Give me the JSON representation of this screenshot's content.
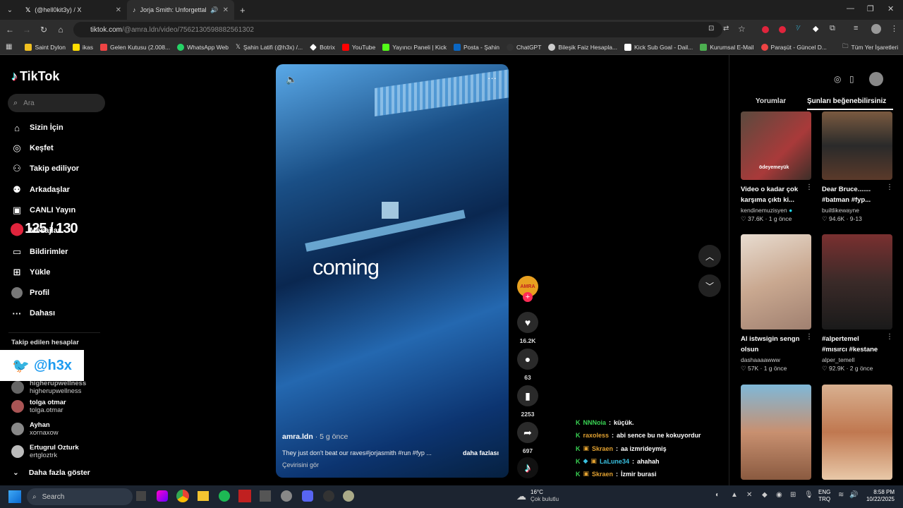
{
  "browser": {
    "tabs": [
      {
        "label": "(@hell0kit3y) / X",
        "active": false
      },
      {
        "label": "Jorja Smith: Unforgettable",
        "active": true
      }
    ],
    "url_host": "tiktok.com",
    "url_path": "/@amra.ldn/video/7562130598882561302",
    "bookmarks": [
      "Saint Dylon",
      "ikas",
      "Gelen Kutusu (2.008...",
      "WhatsApp Web",
      "Şahin Latifi (@h3x) /...",
      "Botrix",
      "YouTube",
      "Yayıncı Paneli | Kick",
      "Posta - Şahin",
      "ChatGPT",
      "Bileşik Faiz Hesapla...",
      "Kick Sub Goal - Dail...",
      "Kurumsal E-Mail",
      "Parașüt - Güncel D..."
    ],
    "all_bookmarks": "Tüm Yer İşaretleri"
  },
  "sidebar": {
    "logo": "TikTok",
    "search_placeholder": "Ara",
    "nav": [
      "Sizin İçin",
      "Keşfet",
      "Takip ediliyor",
      "Arkadaşlar",
      "CANLI Yayın",
      "Mesajlar",
      "Bildirimler",
      "Yükle",
      "Profil",
      "Dahası"
    ],
    "following_title": "Takip edilen hesaplar",
    "accounts": [
      {
        "name": "higherupwellness",
        "user": "higherupwellness"
      },
      {
        "name": "tolga otmar",
        "user": "tolga.otmar"
      },
      {
        "name": "Ayhan",
        "user": "xornaxow"
      },
      {
        "name": "Ertugrul Ozturk",
        "user": "ertgloztrk"
      }
    ],
    "show_more": "Daha fazla göster"
  },
  "overlay": {
    "counter": "125 / 130",
    "twitter": "@h3x"
  },
  "video": {
    "caption_word": "coming",
    "author": "amra.ldn",
    "time": "5 g önce",
    "desc": "They just don't beat our raves#jorjasmith #run #fyp ...",
    "more": "daha fazlası",
    "translate": "Çevirisini gör",
    "likes": "16.2K",
    "comments": "63",
    "saves": "2253",
    "shares": "697"
  },
  "panel": {
    "tab_comments": "Yorumlar",
    "tab_like": "Şunları beğenebilirsiniz",
    "cards": [
      {
        "title1": "Video o kadar çok",
        "title2": "karşıma çıktı ki...",
        "user": "kendinemuzisyen",
        "likes": "37.6K",
        "time": "1 g önce",
        "thumb_text": "ödeyemeyük"
      },
      {
        "title1": "Dear Bruce.......",
        "title2": "#batman #fyp...",
        "user": "builtlikewayne",
        "likes": "94.6K",
        "time": "9-13",
        "thumb_text": ""
      },
      {
        "title1": "Al istwsigin sengn",
        "title2": "olsun",
        "user": "dashaaaawww",
        "likes": "57K",
        "time": "1 g önce",
        "thumb_text": ""
      },
      {
        "title1": "#alpertemel",
        "title2": "#mısırcı #kestane",
        "user": "alper_temell",
        "likes": "92.9K",
        "time": "2 g önce",
        "thumb_text": ""
      }
    ]
  },
  "chat": [
    {
      "user": "NNNoia",
      "msg": "küçük.",
      "color": "#39d353"
    },
    {
      "user": "raxoless",
      "msg": "abi sence bu ne kokuyordur",
      "color": "#e0a030"
    },
    {
      "user": "Skraen",
      "msg": "aa izmrideymiş",
      "color": "#e0a030"
    },
    {
      "user": "LaLune34",
      "msg": "ahahah",
      "color": "#39c0e0"
    },
    {
      "user": "Skraen",
      "msg": "İzmir burasi",
      "color": "#e0a030"
    }
  ],
  "taskbar": {
    "search": "Search",
    "temp": "16°C",
    "weather": "Çok bulutlu",
    "lang1": "ENG",
    "lang2": "TRQ",
    "time": "8:58 PM",
    "date": "10/22/2025"
  }
}
